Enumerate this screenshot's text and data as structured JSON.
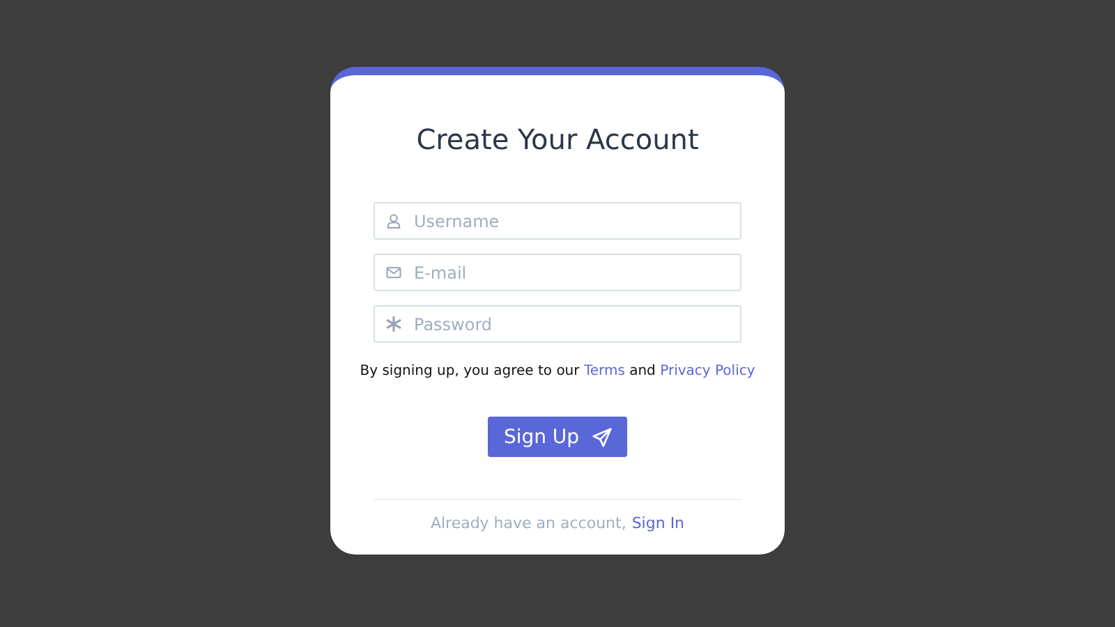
{
  "title": "Create Your Account",
  "fields": [
    {
      "kind": "user",
      "placeholder": "Username"
    },
    {
      "kind": "mail",
      "placeholder": "E-mail"
    },
    {
      "kind": "password",
      "placeholder": "Password"
    }
  ],
  "agreement": [
    {
      "kind": "text",
      "text": "By signing up, you agree to our"
    },
    {
      "kind": "link",
      "text": "Terms"
    },
    {
      "kind": "text",
      "text": "and"
    },
    {
      "kind": "link",
      "text": "Privacy Policy"
    }
  ],
  "submit_button": {
    "label": "Sign Up"
  },
  "footer": {
    "text": "Already have an account,",
    "link": "Sign In"
  }
}
